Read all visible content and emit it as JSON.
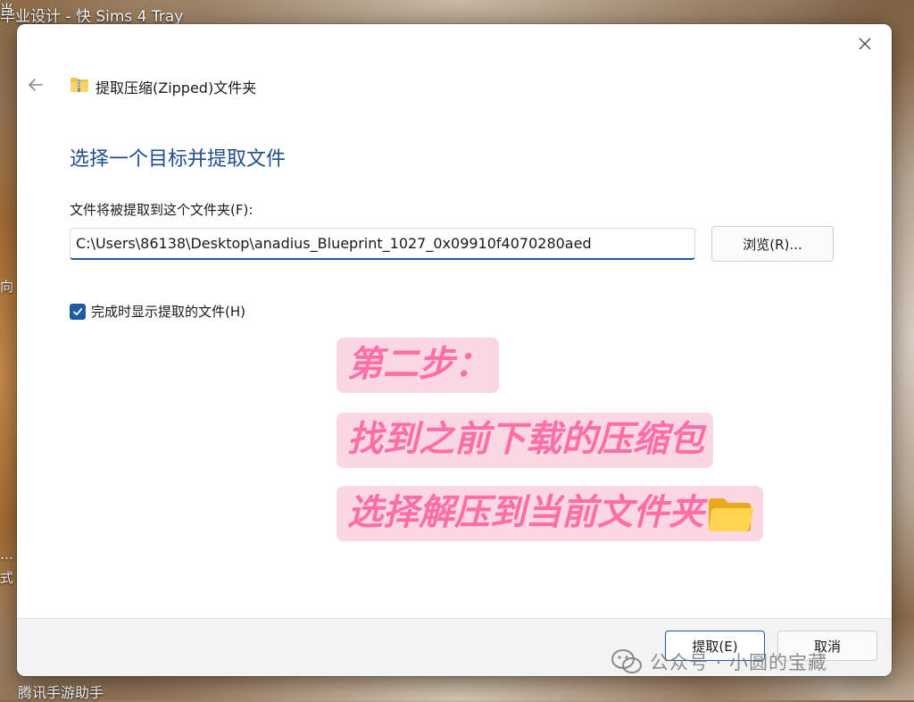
{
  "desktop": {
    "top_icon_labels": "毕业设计 - 快   Sims 4 Tray",
    "bottom_icon_label": "腾讯手游助手",
    "edge_chars": [
      "当",
      "向",
      "…",
      "式"
    ]
  },
  "dialog": {
    "title": "提取压缩(Zipped)文件夹",
    "heading": "选择一个目标并提取文件",
    "path_label": "文件将被提取到这个文件夹(F):",
    "path_value": "C:\\Users\\86138\\Desktop\\anadius_Blueprint_1027_0x09910f4070280aed",
    "browse_label": "浏览(R)...",
    "show_files_label": "完成时显示提取的文件(H)",
    "show_files_checked": true,
    "extract_label": "提取(E)",
    "cancel_label": "取消"
  },
  "annotation": {
    "line1": "第二步：",
    "line2": "找到之前下载的压缩包",
    "line3": "选择解压到当前文件夹",
    "text_color": "#ff6ea6",
    "highlight_color": "#fbd7e3"
  },
  "watermark": {
    "text": "公众号 · 小圆的宝藏"
  },
  "colors": {
    "accent": "#1f5aa6",
    "heading": "#1f4e8c"
  },
  "icons": {
    "title": "folder-zip-icon",
    "annotation": "folder-icon",
    "back": "arrow-left-icon",
    "close": "close-icon",
    "watermark": "wechat-icon"
  }
}
